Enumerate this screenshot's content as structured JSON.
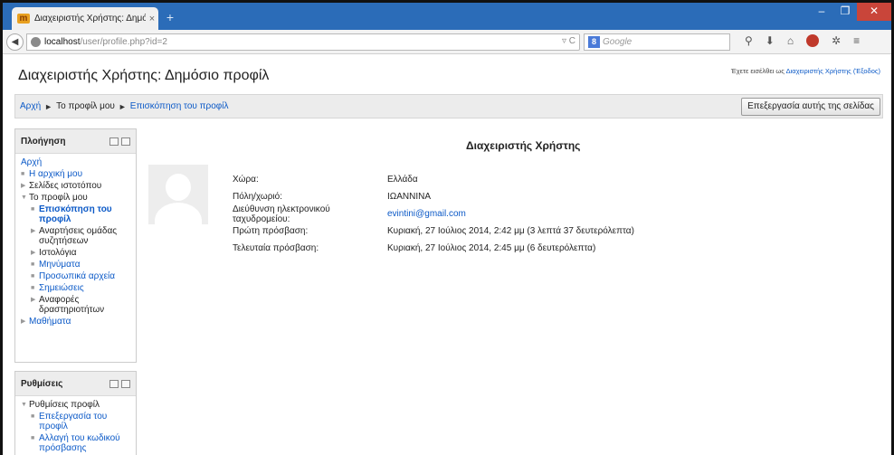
{
  "browser": {
    "tab_title": "Διαχειριστής Χρήστης: Δημόσ...",
    "tab_close": "×",
    "new_tab": "+",
    "url_host": "localhost",
    "url_path": "/user/profile.php?id=2",
    "search_placeholder": "Google",
    "window_controls": {
      "minimize": "–",
      "maximize": "❐",
      "close": "✕"
    }
  },
  "page": {
    "heading": "Διαχειριστής Χρήστης: Δημόσιο προφίλ",
    "login_prefix": "Έχετε εισέλθει ως ",
    "login_user": "Διαχειριστής Χρήστης",
    "login_logout": "(Έξοδος)",
    "breadcrumb": {
      "home": "Αρχή",
      "sep": "►",
      "profile": "Το προφίλ μου",
      "current": "Επισκόπηση του προφίλ"
    },
    "edit_button": "Επεξεργασία αυτής της σελίδας"
  },
  "navigation_block": {
    "title": "Πλοήγηση",
    "home": "Αρχή",
    "items": [
      {
        "label": "Η αρχική μου",
        "marker": "■",
        "type": "link",
        "level": 1
      },
      {
        "label": "Σελίδες ιστοτόπου",
        "marker": "▶",
        "type": "text",
        "level": 1
      },
      {
        "label": "Το προφίλ μου",
        "marker": "▼",
        "type": "text",
        "level": 1
      },
      {
        "label": "Επισκόπηση του προφίλ",
        "marker": "■",
        "type": "current",
        "level": 2
      },
      {
        "label": "Αναρτήσεις ομάδας συζητήσεων",
        "marker": "▶",
        "type": "text",
        "level": 2
      },
      {
        "label": "Ιστολόγια",
        "marker": "▶",
        "type": "text",
        "level": 2
      },
      {
        "label": "Μηνύματα",
        "marker": "■",
        "type": "link",
        "level": 2
      },
      {
        "label": "Προσωπικά αρχεία",
        "marker": "■",
        "type": "link",
        "level": 2
      },
      {
        "label": "Σημειώσεις",
        "marker": "■",
        "type": "link",
        "level": 2
      },
      {
        "label": "Αναφορές δραστηριοτήτων",
        "marker": "▶",
        "type": "text",
        "level": 2
      },
      {
        "label": "Μαθήματα",
        "marker": "▶",
        "type": "link",
        "level": 1
      }
    ]
  },
  "settings_block": {
    "title": "Ρυθμίσεις",
    "items": [
      {
        "label": "Ρυθμίσεις προφίλ",
        "marker": "▼",
        "type": "text",
        "level": 1
      },
      {
        "label": "Επεξεργασία του προφίλ",
        "marker": "■",
        "type": "link",
        "level": 2
      },
      {
        "label": "Αλλαγή του κωδικού πρόσβασης",
        "marker": "■",
        "type": "link",
        "level": 2
      }
    ]
  },
  "profile": {
    "name": "Διαχειριστής Χρήστης",
    "fields": [
      {
        "label": "Χώρα:",
        "value": "Ελλάδα",
        "is_link": false
      },
      {
        "label": "Πόλη/χωριό:",
        "value": "ΙΩΑΝΝΙΝΑ",
        "is_link": false
      },
      {
        "label": "Διεύθυνση ηλεκτρονικού ταχυδρομείου:",
        "value": "evintini@gmail.com",
        "is_link": true
      },
      {
        "label": "Πρώτη πρόσβαση:",
        "value": "Κυριακή, 27 Ιούλιος 2014, 2:42 μμ  (3 λεπτά 37 δευτερόλεπτα)",
        "is_link": false
      },
      {
        "label": "Τελευταία πρόσβαση:",
        "value": "Κυριακή, 27 Ιούλιος 2014, 2:45 μμ  (6 δευτερόλεπτα)",
        "is_link": false
      }
    ]
  },
  "colors": {
    "link": "#0b59c7",
    "titlebar": "#2b6cb8"
  }
}
